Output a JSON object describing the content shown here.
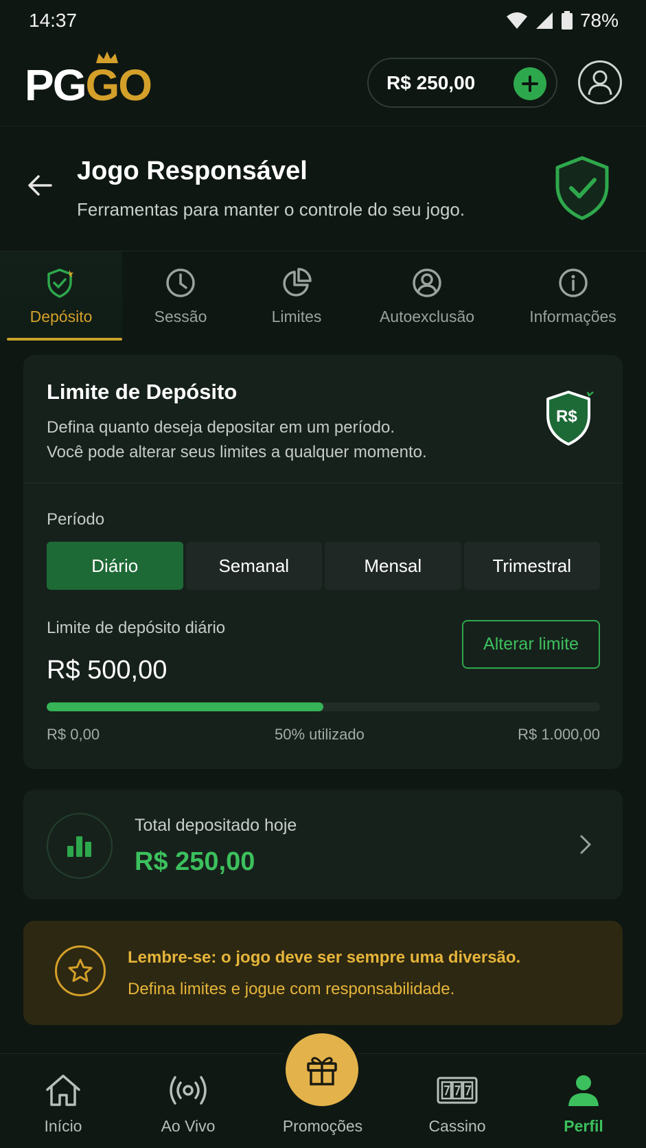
{
  "status_bar": {
    "time": "14:37",
    "battery": "78%"
  },
  "header": {
    "logo_left": "PG",
    "logo_right": "GO",
    "balance": "R$ 250,00"
  },
  "page": {
    "title": "Jogo Responsável",
    "subtitle": "Ferramentas para manter o controle do seu jogo."
  },
  "tabs": [
    {
      "label": "Depósito",
      "icon": "shield-check-icon",
      "active": true
    },
    {
      "label": "Sessão",
      "icon": "clock-icon",
      "active": false
    },
    {
      "label": "Limites",
      "icon": "pie-chart-icon",
      "active": false
    },
    {
      "label": "Autoexclusão",
      "icon": "user-circle-icon",
      "active": false
    },
    {
      "label": "Informações",
      "icon": "info-icon",
      "active": false
    }
  ],
  "deposit_card": {
    "title": "Limite de Depósito",
    "desc_line1": "Defina quanto deseja depositar em um período.",
    "desc_line2": "Você pode alterar seus limites a qualquer momento.",
    "shield_text": "R$",
    "period_label": "Período",
    "periods": [
      "Diário",
      "Semanal",
      "Mensal",
      "Trimestral"
    ],
    "selected_period": "Diário",
    "limit_label": "Limite de depósito diário",
    "limit_value": "R$ 500,00",
    "alter_button": "Alterar limite",
    "progress_fraction": 0.5,
    "progress_min": "R$ 0,00",
    "progress_used": "50% utilizado",
    "progress_max": "R$ 1.000,00"
  },
  "total_card": {
    "label": "Total depositado hoje",
    "value": "R$ 250,00"
  },
  "reminder": {
    "title": "Lembre-se: o jogo deve ser sempre uma diversão.",
    "text": "Defina limites e jogue com responsabilidade."
  },
  "bottom_nav": [
    {
      "label": "Início",
      "icon": "home-icon"
    },
    {
      "label": "Ao Vivo",
      "icon": "live-icon"
    },
    {
      "label": "Promoções",
      "icon": "gift-icon"
    },
    {
      "label": "Cassino",
      "icon": "slot-machine-icon"
    },
    {
      "label": "Perfil",
      "icon": "user-icon",
      "active": true
    }
  ],
  "colors": {
    "accent_green": "#2ea84c",
    "accent_gold": "#d4a02a",
    "background": "#0e1712",
    "card": "#17211c"
  }
}
